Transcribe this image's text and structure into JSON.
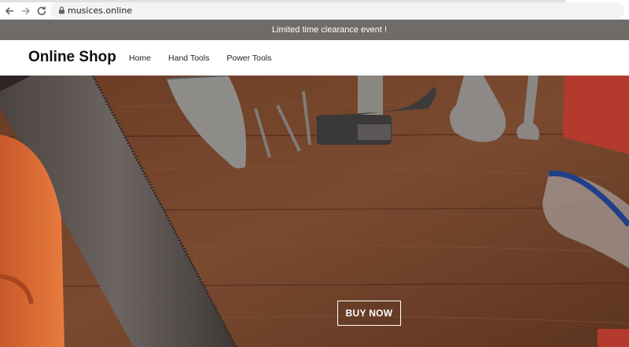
{
  "browser": {
    "url": "musices.online"
  },
  "announcement": {
    "text": "Limited time clearance event !"
  },
  "header": {
    "logo": "Online Shop",
    "nav": [
      "Home",
      "Hand Tools",
      "Power Tools"
    ]
  },
  "hero": {
    "button_label": "BUY NOW"
  },
  "colors": {
    "announcement_bg": "#6f6b68",
    "hero_wood": "#6a3f27",
    "button_border": "#ffffff"
  }
}
